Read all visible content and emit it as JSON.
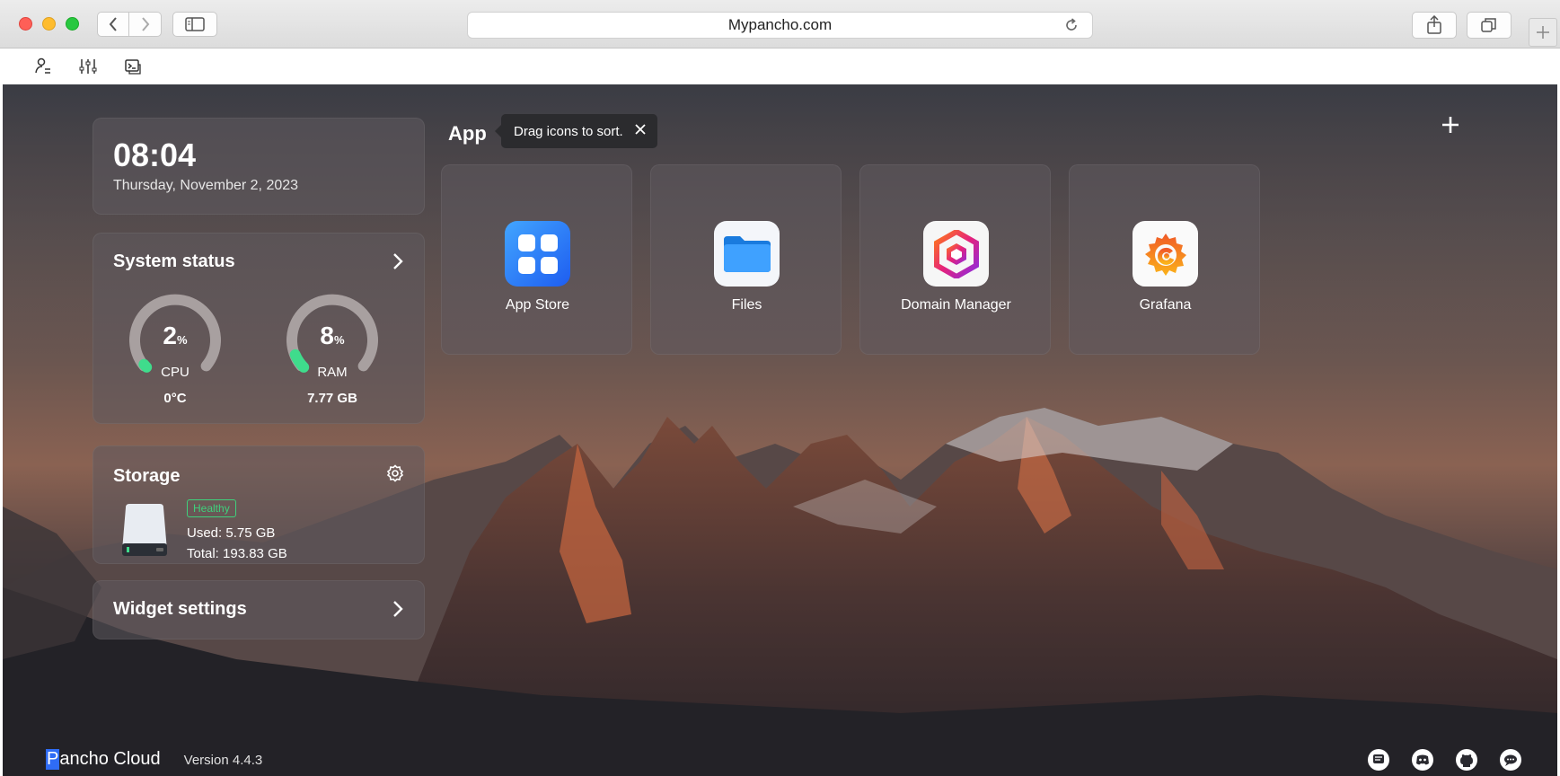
{
  "browser": {
    "url": "Mypancho.com",
    "icons": [
      "back-icon",
      "forward-icon",
      "sidebar-icon",
      "reload-icon",
      "share-icon",
      "tabs-icon",
      "plus-icon"
    ]
  },
  "toolbar": {
    "icons": [
      "user-list-icon",
      "sliders-icon",
      "terminal-icon"
    ]
  },
  "widgets": {
    "clock": {
      "time": "08:04",
      "date": "Thursday, November 2, 2023"
    },
    "system_status": {
      "title": "System status",
      "cpu": {
        "value": "2",
        "unit": "%",
        "label": "CPU",
        "sub": "0°C",
        "percent": 2
      },
      "ram": {
        "value": "8",
        "unit": "%",
        "label": "RAM",
        "sub": "7.77 GB",
        "percent": 8
      }
    },
    "storage": {
      "title": "Storage",
      "status": "Healthy",
      "used": "Used: 5.75 GB",
      "total": "Total: 193.83 GB"
    },
    "settings": {
      "title": "Widget settings"
    }
  },
  "apps": {
    "title": "App",
    "tooltip": "Drag icons to sort.",
    "items": [
      {
        "name": "App Store",
        "icon": "app-store-icon"
      },
      {
        "name": "Files",
        "icon": "folder-icon"
      },
      {
        "name": "Domain Manager",
        "icon": "domain-manager-icon"
      },
      {
        "name": "Grafana",
        "icon": "grafana-icon"
      }
    ]
  },
  "footer": {
    "brand_initial": "P",
    "brand_rest": "ancho Cloud",
    "version": "Version 4.4.3",
    "icons": [
      "feedback-icon",
      "discord-icon",
      "github-icon",
      "chat-icon"
    ]
  },
  "colors": {
    "accent": "#2f6cf6",
    "gauge_active": "#3fdc8c",
    "healthy": "#3fd17c"
  }
}
